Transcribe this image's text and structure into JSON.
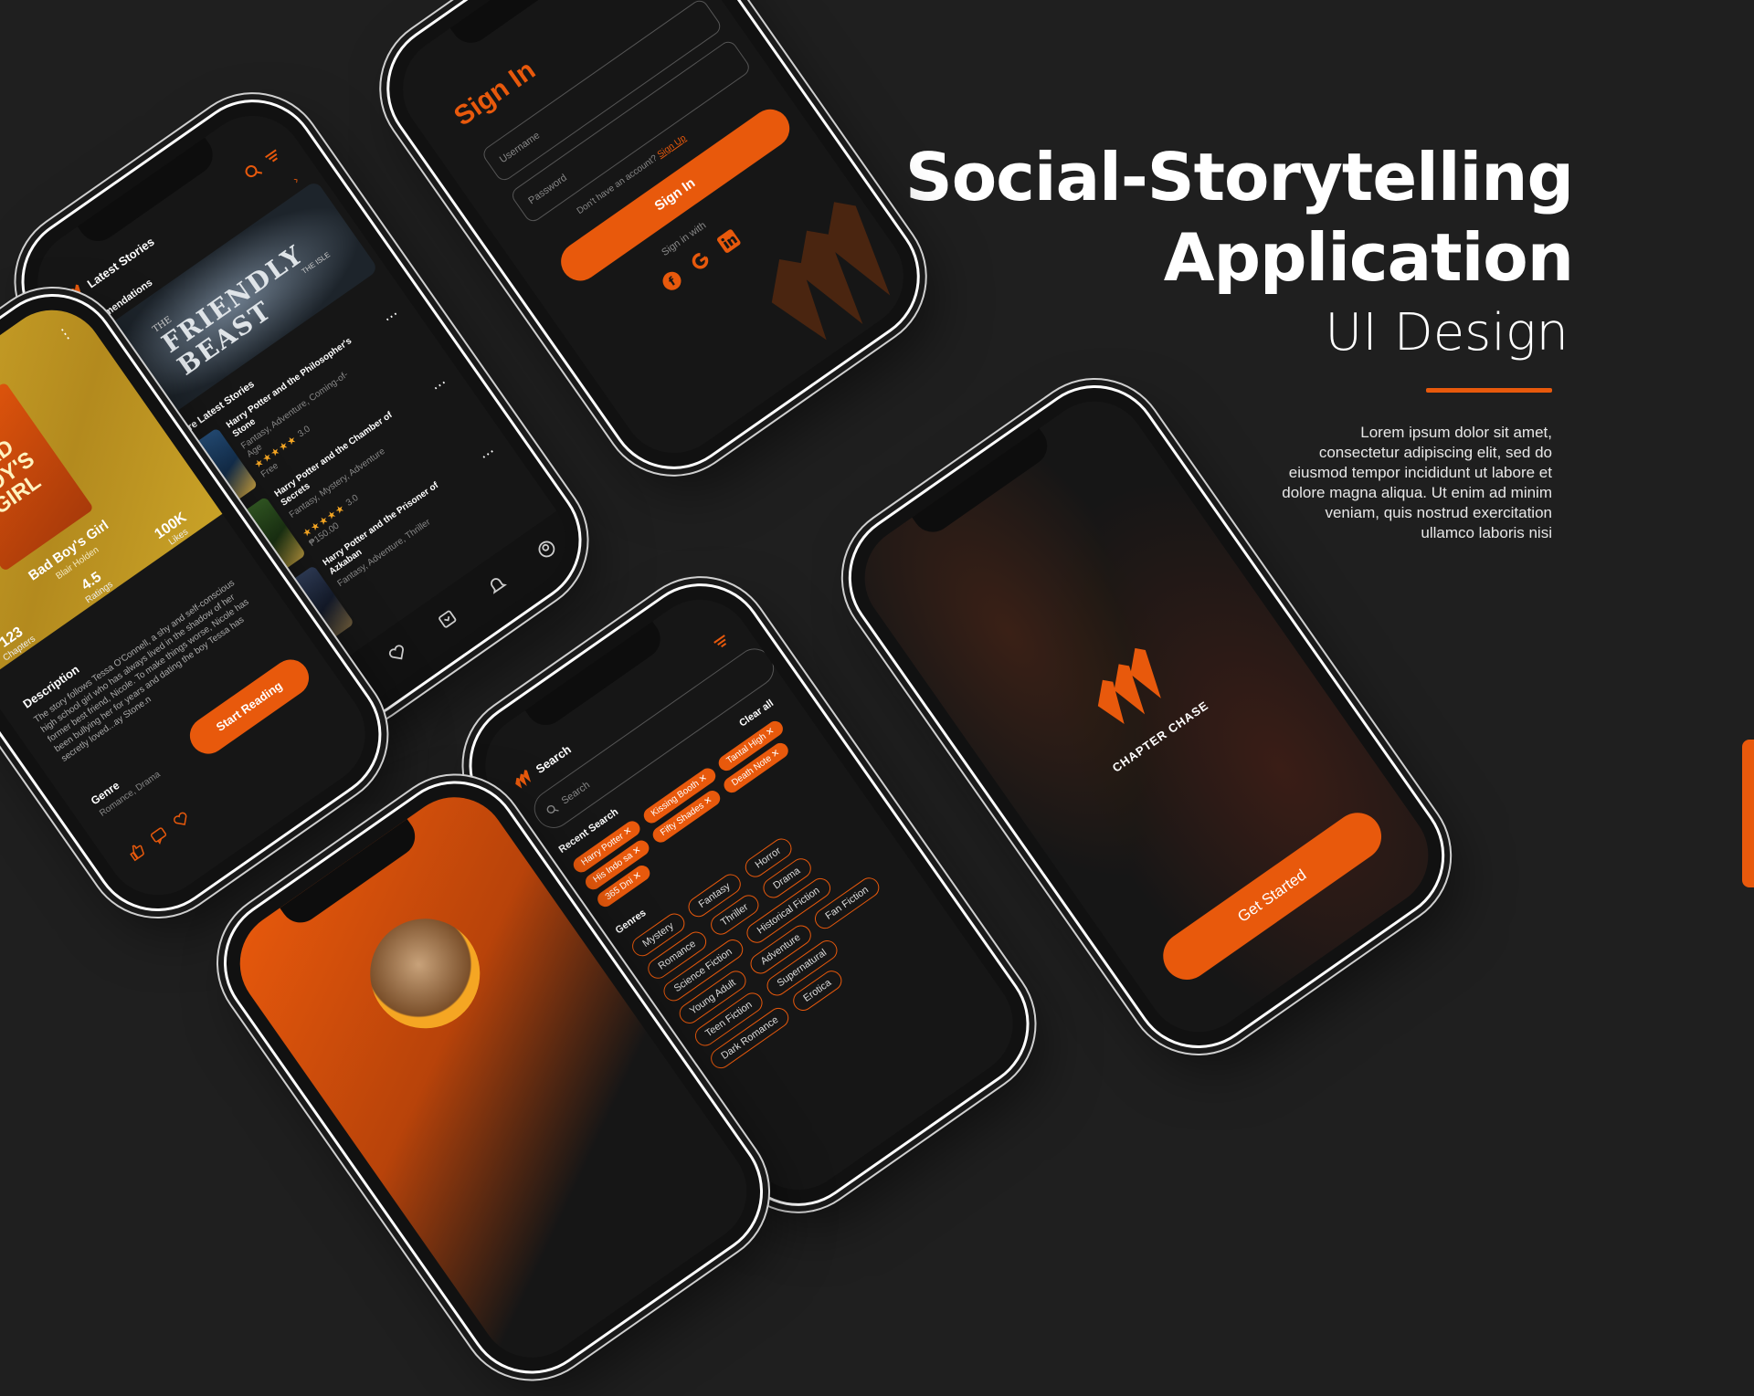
{
  "hero": {
    "title_line1": "Social-Storytelling",
    "title_line2": "Application",
    "subtitle": "UI Design",
    "description": "Lorem ipsum dolor sit amet, consectetur adipiscing elit, sed do eiusmod tempor incididunt ut labore et dolore magna aliqua. Ut enim ad minim veniam, quis nostrud exercitation ullamco laboris nisi"
  },
  "colors": {
    "accent": "#e8590c",
    "background": "#1f1f1f",
    "gold": "#c9a227"
  },
  "signin": {
    "title": "Sign In",
    "username_placeholder": "Username",
    "password_placeholder": "Password",
    "no_account": "Don't have an account?",
    "signup_link": "Sign Up",
    "button": "Sign In",
    "sign_in_with": "Sign in with",
    "providers": [
      "facebook-icon",
      "google-icon",
      "linkedin-icon"
    ]
  },
  "stories": {
    "header": "Latest Stories",
    "recommendations": "Recomendations",
    "featured_title": "FRIENDLY BEAST",
    "featured_prefix": "THE",
    "featured_suffix": "THE ISLE",
    "explore": "Explore Latest Stories",
    "books": [
      {
        "title": "Harry Potter and the Philosopher's Stone",
        "genre": "Fantasy, Adventure, Coming-of-Age",
        "rating": "3.0",
        "price": "Free"
      },
      {
        "title": "Harry Potter and the Chamber of Secrets",
        "genre": "Fantasy, Mystery, Adventure",
        "rating": "3.0",
        "price": "₱150.00"
      },
      {
        "title": "Harry Potter and the Prisoner of Azkaban",
        "genre": "Fantasy, Adventure, Thriller",
        "rating": "",
        "price": ""
      }
    ]
  },
  "detail": {
    "book_title": "Bad Boy's Girl",
    "author": "Blair Holden",
    "cover_text": "BAD BOY'S GIRL",
    "stats": [
      {
        "value": "123",
        "label": "Chapters"
      },
      {
        "value": "4.5",
        "label": "Ratings"
      },
      {
        "value": "100K",
        "label": "Likes"
      }
    ],
    "description_heading": "Description",
    "description": "The story follows Tessa O'Connell, a shy and self-conscious high school girl who has always lived in the shadow of her former best friend, Nicole. To make things worse, Nicole has been bullying her for years and dating the boy Tessa has secretly loved...ay Stone.n",
    "genre_heading": "Genre",
    "genres": "Romance, Drama",
    "button": "Start Reading"
  },
  "search": {
    "title": "Search",
    "placeholder": "Search",
    "recent_heading": "Recent Search",
    "clear_all": "Clear all",
    "recent": [
      "Harry Potter",
      "Kissing Booth",
      "Tantal High",
      "His Indo sa",
      "Fifty Shades",
      "Death Note",
      "365 Dni"
    ],
    "genres_heading": "Genres",
    "genres": [
      "Mystery",
      "Fantasy",
      "Horror",
      "Romance",
      "Thriller",
      "Drama",
      "Science Fiction",
      "Historical Fiction",
      "Young Adult",
      "Adventure",
      "Fan Fiction",
      "Teen Fiction",
      "Supernatural",
      "Dark Romance",
      "Erotica"
    ]
  },
  "splash": {
    "brand": "CHAPTER CHASE",
    "button": "Get Started"
  }
}
